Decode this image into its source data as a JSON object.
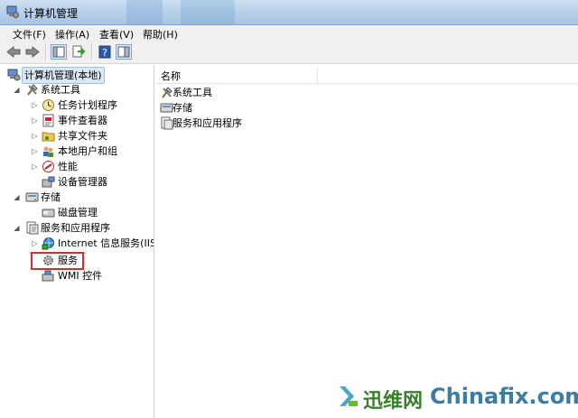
{
  "window": {
    "title": "计算机管理"
  },
  "menu": [
    "文件(F)",
    "操作(A)",
    "查看(V)",
    "帮助(H)"
  ],
  "toolbar": {
    "icons": [
      "back-arrow-icon",
      "forward-arrow-icon",
      "show-hide-tree-icon",
      "export-list-icon",
      "help-icon",
      "properties-pane-icon"
    ]
  },
  "tree": {
    "root": "计算机管理(本地)",
    "system_tools": "系统工具",
    "task_scheduler": "任务计划程序",
    "event_viewer": "事件查看器",
    "shared_folders": "共享文件夹",
    "local_users": "本地用户和组",
    "performance": "性能",
    "device_manager": "设备管理器",
    "storage": "存储",
    "disk_management": "磁盘管理",
    "services_apps": "服务和应用程序",
    "iis": "Internet 信息服务(IIS)管",
    "services": "服务",
    "wmi": "WMI 控件"
  },
  "list": {
    "column_name": "名称",
    "items": [
      "系统工具",
      "存储",
      "服务和应用程序"
    ]
  },
  "watermark": {
    "cn": "迅维网",
    "en": "Chinafix.com"
  },
  "colors": {
    "highlight_box": "#e02a2a",
    "titlebar": "#b9d1ea",
    "watermark_green": "#3a7f2c",
    "watermark_blue": "#3c7ea3"
  }
}
